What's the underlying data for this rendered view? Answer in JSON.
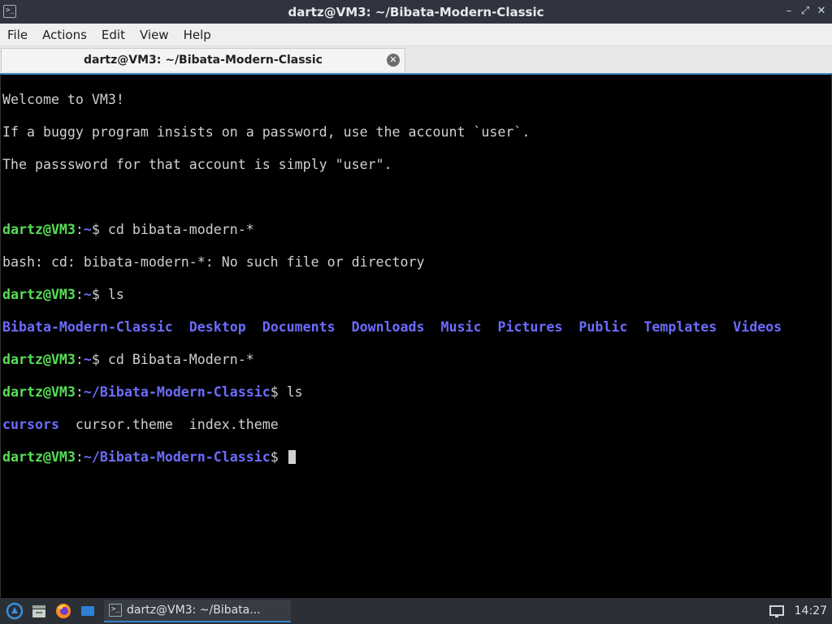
{
  "window": {
    "title": "dartz@VM3: ~/Bibata-Modern-Classic",
    "app_icon": ">_",
    "controls": {
      "minimize": "–",
      "maximize": "⤢",
      "close": "✕"
    }
  },
  "menubar": {
    "items": [
      {
        "label": "File"
      },
      {
        "label": "Actions"
      },
      {
        "label": "Edit"
      },
      {
        "label": "View"
      },
      {
        "label": "Help"
      }
    ]
  },
  "tab": {
    "label": "dartz@VM3: ~/Bibata-Modern-Classic",
    "close": "✕"
  },
  "terminal": {
    "motd": [
      "Welcome to VM3!",
      "If a buggy program insists on a password, use the account `user`.",
      "The passsword for that account is simply \"user\"."
    ],
    "prompt_user": "dartz@VM3",
    "cmd1": {
      "path": "~",
      "command": "cd bibata-modern-*"
    },
    "error1": "bash: cd: bibata-modern-*: No such file or directory",
    "cmd2": {
      "path": "~",
      "command": "ls"
    },
    "ls_home": [
      {
        "name": "Bibata-Modern-Classic",
        "type": "dir"
      },
      {
        "name": "Desktop",
        "type": "dir"
      },
      {
        "name": "Documents",
        "type": "dir"
      },
      {
        "name": "Downloads",
        "type": "dir"
      },
      {
        "name": "Music",
        "type": "dir"
      },
      {
        "name": "Pictures",
        "type": "dir"
      },
      {
        "name": "Public",
        "type": "dir"
      },
      {
        "name": "Templates",
        "type": "dir"
      },
      {
        "name": "Videos",
        "type": "dir"
      }
    ],
    "cmd3": {
      "path": "~",
      "command": "cd Bibata-Modern-*"
    },
    "cmd4": {
      "path": "~/Bibata-Modern-Classic",
      "command": "ls"
    },
    "ls_theme": [
      {
        "name": "cursors",
        "type": "dir"
      },
      {
        "name": "cursor.theme",
        "type": "file"
      },
      {
        "name": "index.theme",
        "type": "file"
      }
    ],
    "cmd5": {
      "path": "~/Bibata-Modern-Classic",
      "command": ""
    }
  },
  "taskbar": {
    "task_label": "dartz@VM3: ~/Bibata...",
    "clock": "14:27"
  },
  "colors": {
    "prompt_user": "#55e055",
    "prompt_path": "#6c6cff",
    "directory": "#6c6cff",
    "text": "#d0d0d0",
    "accent": "#3b82c4"
  }
}
